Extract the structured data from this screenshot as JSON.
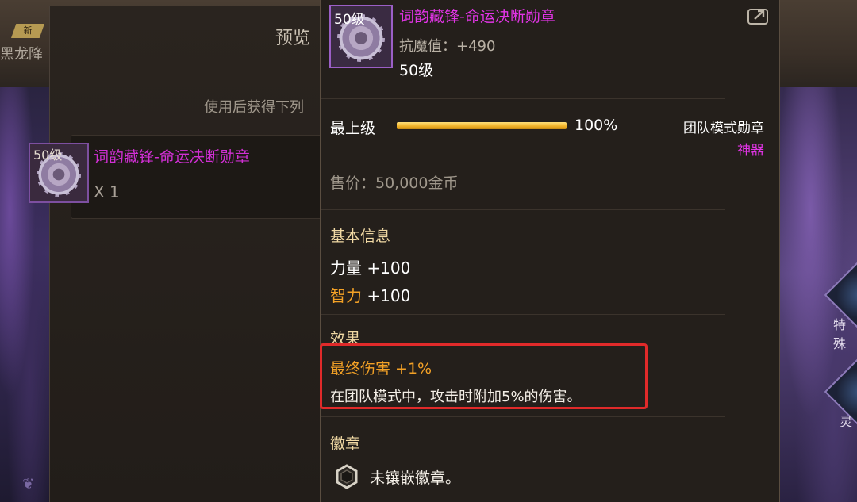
{
  "background": {
    "new_badge": "新",
    "left_title": "黑龙降",
    "side_buttons": [
      "特殊",
      "灵"
    ]
  },
  "preview": {
    "title": "预览",
    "subtitle": "使用后获得下列",
    "item": {
      "level_badge": "50级",
      "name": "词韵藏锋-命运决断勋章",
      "quantity": "X 1"
    }
  },
  "tooltip": {
    "level_badge": "50级",
    "item_name": "词韵藏锋-命运决断勋章",
    "stat": "抗魔值：+490",
    "level": "50级",
    "grade": {
      "label": "最上级",
      "percent_text": "100%",
      "fill_fraction": 1.0
    },
    "item_type": "团队模式勋章",
    "rarity": "神器",
    "price": "售价：50,000金币",
    "basic_info": {
      "title": "基本信息",
      "attributes": [
        {
          "name": "力量",
          "value": "+100"
        },
        {
          "name": "智力",
          "value": "+100"
        }
      ]
    },
    "effect": {
      "title": "效果",
      "name": "最终伤害 +1%",
      "description": "在团队模式中，攻击时附加5%的伤害。"
    },
    "badge_socket": {
      "title": "徽章",
      "status": "未镶嵌徽章。"
    }
  },
  "colors": {
    "rarity_magenta": "#e234e6",
    "highlight_orange": "#f3a126",
    "callout_red": "#e02a2a",
    "section_gold": "#f1d9a4"
  }
}
